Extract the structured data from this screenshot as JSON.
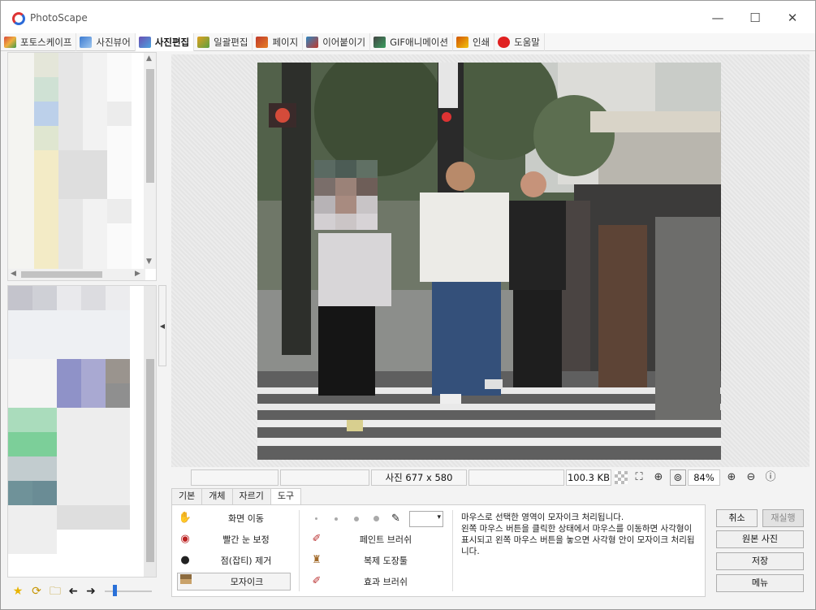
{
  "window": {
    "title": "PhotoScape",
    "minimize": "—",
    "maximize": "☐",
    "close": "✕"
  },
  "tabs": [
    {
      "label": "포토스케이프",
      "color": "#d8473c"
    },
    {
      "label": "사진뷰어",
      "color": "#3d7bd1"
    },
    {
      "label": "사진편집",
      "color": "#6a4fb3"
    },
    {
      "label": "일괄편집",
      "color": "#e0a020"
    },
    {
      "label": "페이지",
      "color": "#c0392b"
    },
    {
      "label": "이어붙이기",
      "color": "#2e86c1"
    },
    {
      "label": "GIF애니메이션",
      "color": "#444444"
    },
    {
      "label": "인쇄",
      "color": "#d35400"
    },
    {
      "label": "도움말",
      "color": "#e02020"
    }
  ],
  "active_tab": "사진편집",
  "left_tools": {
    "star": "★",
    "refresh": "⟳",
    "folder": "🗀",
    "back": "➜",
    "forward": "➜"
  },
  "status": {
    "cell1": "",
    "cell2": "",
    "dimensions": "사진 677 x 580",
    "cell4": "",
    "filesize": "100.3 KB",
    "zoom": "84%"
  },
  "subtabs": [
    "기본",
    "개체",
    "자르기",
    "도구"
  ],
  "active_subtab": "도구",
  "tools_left": [
    {
      "label": "화면 이동",
      "icon": "hand-icon"
    },
    {
      "label": "빨간 눈 보정",
      "icon": "eye-icon"
    },
    {
      "label": "점(잡티) 제거",
      "icon": "spot-icon"
    },
    {
      "label": "모자이크",
      "icon": "mosaic-icon"
    }
  ],
  "tools_right": [
    {
      "label": "페인트 브러쉬",
      "icon": "brush-icon"
    },
    {
      "label": "복제 도장툴",
      "icon": "stamp-icon"
    },
    {
      "label": "효과 브러쉬",
      "icon": "effect-brush-icon"
    }
  ],
  "help_text": "마우스로 선택한 영역이 모자이크 처리됩니다.\n왼쪽 마우스 버튼을 클릭한 상태에서 마우스를 이동하면 사각형이 표시되고 왼쪽 마우스 버튼을 놓으면 사각형 안이 모자이크 처리됩니다.",
  "right_buttons": {
    "cancel": "취소",
    "redo": "재실행",
    "original": "원본 사진",
    "save": "저장",
    "menu": "메뉴"
  }
}
